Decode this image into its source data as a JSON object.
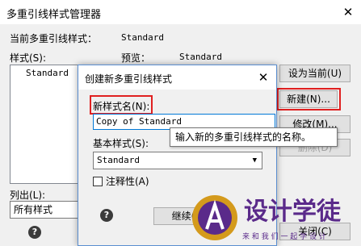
{
  "window": {
    "title": "多重引线样式管理器",
    "close_glyph": "✕",
    "current_style_label": "当前多重引线样式：",
    "current_style_value": "Standard",
    "styles_label": "样式(S):",
    "styles_list": [
      "Standard"
    ],
    "preview_label": "预览：",
    "preview_value": "Standard",
    "set_current_button": "设为当前(U)",
    "new_button": "新建(N)...",
    "modify_button": "修改(M)...",
    "delete_button": "删除(D)",
    "list_label": "列出(L):",
    "list_value": "所有样式",
    "close_button": "关闭(C)"
  },
  "dialog": {
    "title": "创建新多重引线样式",
    "close_glyph": "✕",
    "new_name_label": "新样式名(N):",
    "new_name_value": "Copy of Standard",
    "tooltip": "输入新的多重引线样式的名称。",
    "base_style_label": "基本样式(S):",
    "base_style_value": "Standard",
    "annotative_label": "注释性(A)",
    "annotative_checked": false,
    "continue_button": "继续(O)"
  },
  "watermark": {
    "logo_text": "设计学徒",
    "logo_subtext": "来 和 我 们 一 起 学 设 计"
  },
  "colors": {
    "highlight_red": "#e02020",
    "accent_blue": "#0078d7",
    "logo_gold": "#d49a1c",
    "logo_purple": "#5a2a8a"
  }
}
